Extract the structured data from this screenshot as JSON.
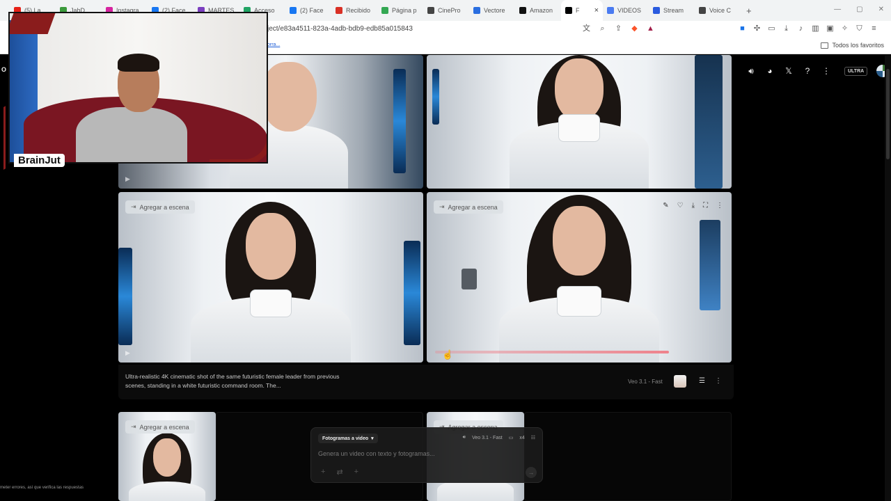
{
  "browser": {
    "tabs": [
      {
        "label": "(5) La",
        "color": "#e62117"
      },
      {
        "label": "JahD",
        "color": "#3c9a3c"
      },
      {
        "label": "Instagra",
        "color": "#d6249f"
      },
      {
        "label": "(2) Face",
        "color": "#1877f2"
      },
      {
        "label": "MARTES",
        "color": "#7b3fbf"
      },
      {
        "label": "Acceso",
        "color": "#21a464"
      },
      {
        "label": "(2) Face",
        "color": "#1877f2"
      },
      {
        "label": "Recibido",
        "color": "#d93025"
      },
      {
        "label": "Página p",
        "color": "#34a853"
      },
      {
        "label": "CinePro",
        "color": "#444444"
      },
      {
        "label": "Vectore",
        "color": "#2a6ee0"
      },
      {
        "label": "Amazon",
        "color": "#111111"
      },
      {
        "label": "F",
        "color": "#000000",
        "active": true
      },
      {
        "label": "VIDEOS",
        "color": "#4a7bf1"
      },
      {
        "label": "Stream",
        "color": "#2a5bdf"
      },
      {
        "label": "Voice C",
        "color": "#444444"
      }
    ],
    "url": "ject/e83a4511-823a-4adb-bdb9-edb85a015843",
    "bookmark_link": "orra...",
    "bookmarks_folder": "Todos los favoritos"
  },
  "app": {
    "left_text": "O",
    "ultra_badge": "ULTRA",
    "bottom_left_text": "meter errores, así que verifica las respuestas",
    "tiles": {
      "add_to_scene": "Agregar a escena"
    },
    "caption": "Ultra-realistic 4K cinematic shot of the same futuristic female leader from previous scenes, standing in a white futuristic command room. The...",
    "model_label": "Veo 3.1 - Fast",
    "prompt": {
      "mode": "Fotogramas a video",
      "model": "Veo 3.1 - Fast",
      "count": "x4",
      "placeholder": "Genera un video con texto y fotogramas..."
    }
  },
  "webcam": {
    "brand": "BrainJut"
  }
}
